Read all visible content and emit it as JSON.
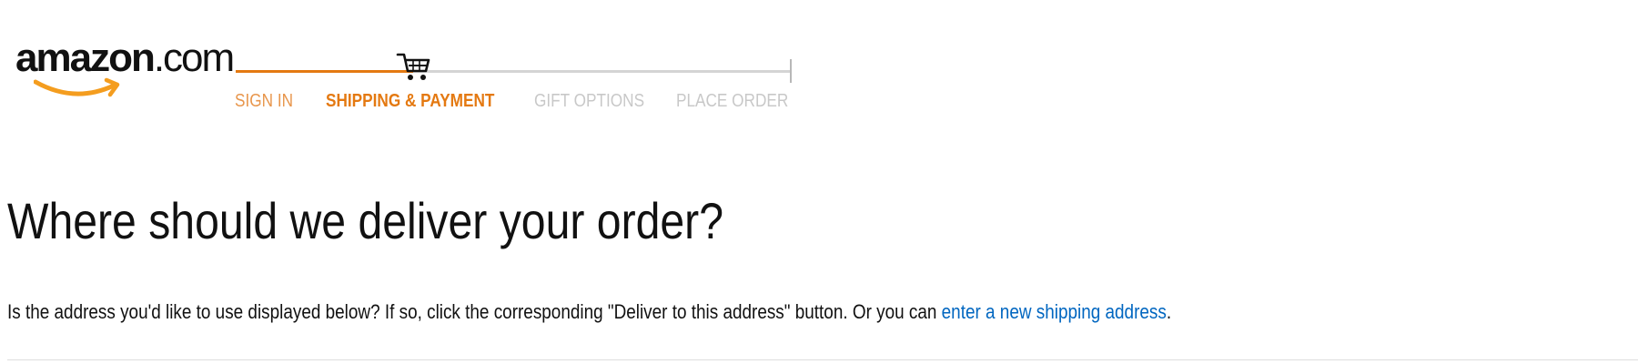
{
  "header": {
    "logo": {
      "text_main": "amazon",
      "text_suffix": ".com",
      "smile_color": "#f49d1f"
    },
    "progress": {
      "active_color": "#e47911",
      "inactive_color": "#c8c8c8",
      "cart_icon": "shopping-cart-icon",
      "steps": [
        {
          "label": "SIGN IN",
          "state": "done"
        },
        {
          "label": "SHIPPING & PAYMENT",
          "state": "current"
        },
        {
          "label": "GIFT OPTIONS",
          "state": "upcoming"
        },
        {
          "label": "PLACE ORDER",
          "state": "upcoming"
        }
      ]
    }
  },
  "main": {
    "title": "Where should we deliver your order?",
    "instructions": {
      "prefix": "Is the address you'd like to use displayed below? If so, click the corresponding \"Deliver to this address\" button. Or you can ",
      "link_text": "enter a new shipping address",
      "suffix": "."
    },
    "link_color": "#0066c0"
  }
}
